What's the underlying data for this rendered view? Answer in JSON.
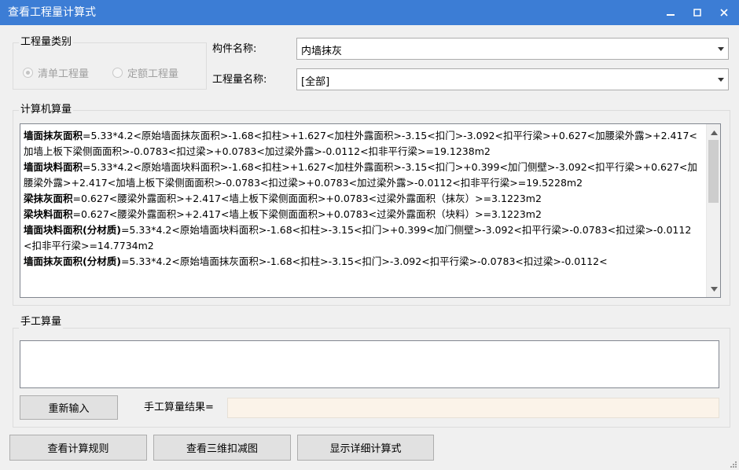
{
  "window": {
    "title": "查看工程量计算式",
    "minimize_glyph": "—",
    "maximize_glyph": "□",
    "close_glyph": "✕"
  },
  "quantity_type": {
    "legend": "工程量类别",
    "option_bill": "清单工程量",
    "option_norm": "定额工程量",
    "selected": "清单工程量"
  },
  "component": {
    "label": "构件名称:",
    "value": "内墙抹灰"
  },
  "quantity_name": {
    "label": "工程量名称:",
    "value": "[全部]"
  },
  "computer_calc": {
    "legend": "计算机算量",
    "lines": [
      {
        "bold": "墙面抹灰面积",
        "text": "=5.33*4.2<原始墙面抹灰面积>-1.68<扣柱>+1.627<加柱外露面积>-3.15<扣门>-3.092<扣平行梁>+0.627<加腰梁外露>+2.417<加墙上板下梁侧面面积>-0.0783<扣过梁>+0.0783<加过梁外露>-0.0112<扣非平行梁>=19.1238m2"
      },
      {
        "bold": "墙面块料面积",
        "text": "=5.33*4.2<原始墙面块料面积>-1.68<扣柱>+1.627<加柱外露面积>-3.15<扣门>+0.399<加门侧壁>-3.092<扣平行梁>+0.627<加腰梁外露>+2.417<加墙上板下梁侧面面积>-0.0783<扣过梁>+0.0783<加过梁外露>-0.0112<扣非平行梁>=19.5228m2"
      },
      {
        "bold": "梁抹灰面积",
        "text": "=0.627<腰梁外露面积>+2.417<墙上板下梁侧面面积>+0.0783<过梁外露面积（抹灰）>=3.1223m2"
      },
      {
        "bold": "梁块料面积",
        "text": "=0.627<腰梁外露面积>+2.417<墙上板下梁侧面面积>+0.0783<过梁外露面积（块料）>=3.1223m2"
      },
      {
        "bold": "墙面块料面积(分材质)",
        "text": "=5.33*4.2<原始墙面块料面积>-1.68<扣柱>-3.15<扣门>+0.399<加门侧壁>-3.092<扣平行梁>-0.0783<扣过梁>-0.0112<扣非平行梁>=14.7734m2"
      },
      {
        "bold": "墙面抹灰面积(分材质)",
        "text": "=5.33*4.2<原始墙面抹灰面积>-1.68<扣柱>-3.15<扣门>-3.092<扣平行梁>-0.0783<扣过梁>-0.0112<"
      }
    ]
  },
  "manual_calc": {
    "legend": "手工算量",
    "input_value": "",
    "reenter_label": "重新输入",
    "result_label": "手工算量结果=",
    "result_value": ""
  },
  "footer": {
    "view_rules_label": "查看计算规则",
    "view_3d_label": "查看三维扣减图",
    "show_detail_label": "显示详细计算式"
  }
}
